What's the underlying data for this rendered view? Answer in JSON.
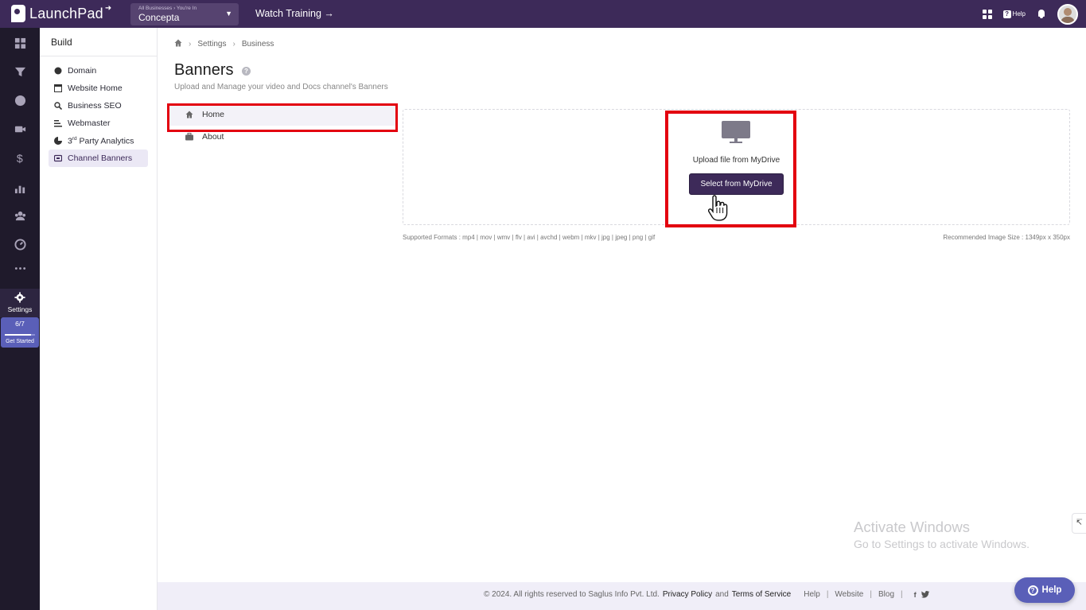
{
  "header": {
    "logo_text": "LaunchPad",
    "business_crumb": "All Businesses › You're In",
    "business_name": "Concepta",
    "watch_training": "Watch Training →",
    "help_label": "Help"
  },
  "rail": {
    "items": [
      "dashboard-icon",
      "funnel-icon",
      "globe-icon",
      "video-icon",
      "dollar-icon",
      "analytics-icon",
      "users-icon",
      "gauge-icon",
      "more-icon"
    ],
    "settings_label": "Settings",
    "progress_text": "6/7",
    "progress_fraction": 0.857,
    "get_started_label": "Get Started"
  },
  "sidebar": {
    "title": "Build",
    "items": [
      {
        "label": "Domain",
        "icon": "domain-icon"
      },
      {
        "label": "Website Home",
        "icon": "website-icon"
      },
      {
        "label": "Business SEO",
        "icon": "seo-icon"
      },
      {
        "label": "Webmaster",
        "icon": "webmaster-icon"
      },
      {
        "label_pre": "3",
        "label_sup": "rd",
        "label_post": " Party Analytics",
        "icon": "analytics-icon"
      },
      {
        "label": "Channel Banners",
        "icon": "banner-icon",
        "active": true
      }
    ]
  },
  "breadcrumb": {
    "items": [
      "Settings",
      "Business"
    ]
  },
  "page": {
    "title": "Banners",
    "help_glyph": "?",
    "subtitle": "Upload and Manage your video and Docs channel's Banners"
  },
  "tabs": [
    {
      "label": "Home",
      "active": true
    },
    {
      "label": "About",
      "active": false
    }
  ],
  "upload": {
    "text": "Upload file from MyDrive",
    "button_label": "Select from MyDrive",
    "formats": "Supported Formats : mp4 | mov | wmv | flv | avi | avchd | webm | mkv | jpg | jpeg | png | gif",
    "recommended": "Recommended Image Size : 1349px x 350px"
  },
  "watermark": {
    "line1": "Activate Windows",
    "line2": "Go to Settings to activate Windows."
  },
  "footer": {
    "copyright": "©  2024. All rights reserved to Saglus Info Pvt. Ltd.",
    "privacy": "Privacy Policy",
    "and": "and",
    "terms": "Terms of Service",
    "links": [
      "Help",
      "Website",
      "Blog"
    ],
    "social": [
      "facebook-icon",
      "twitter-icon"
    ]
  },
  "help_fab": {
    "label": "Help"
  },
  "colors": {
    "brand": "#3d2a59",
    "accent": "#5a5fb8",
    "highlight": "#e3000f"
  }
}
